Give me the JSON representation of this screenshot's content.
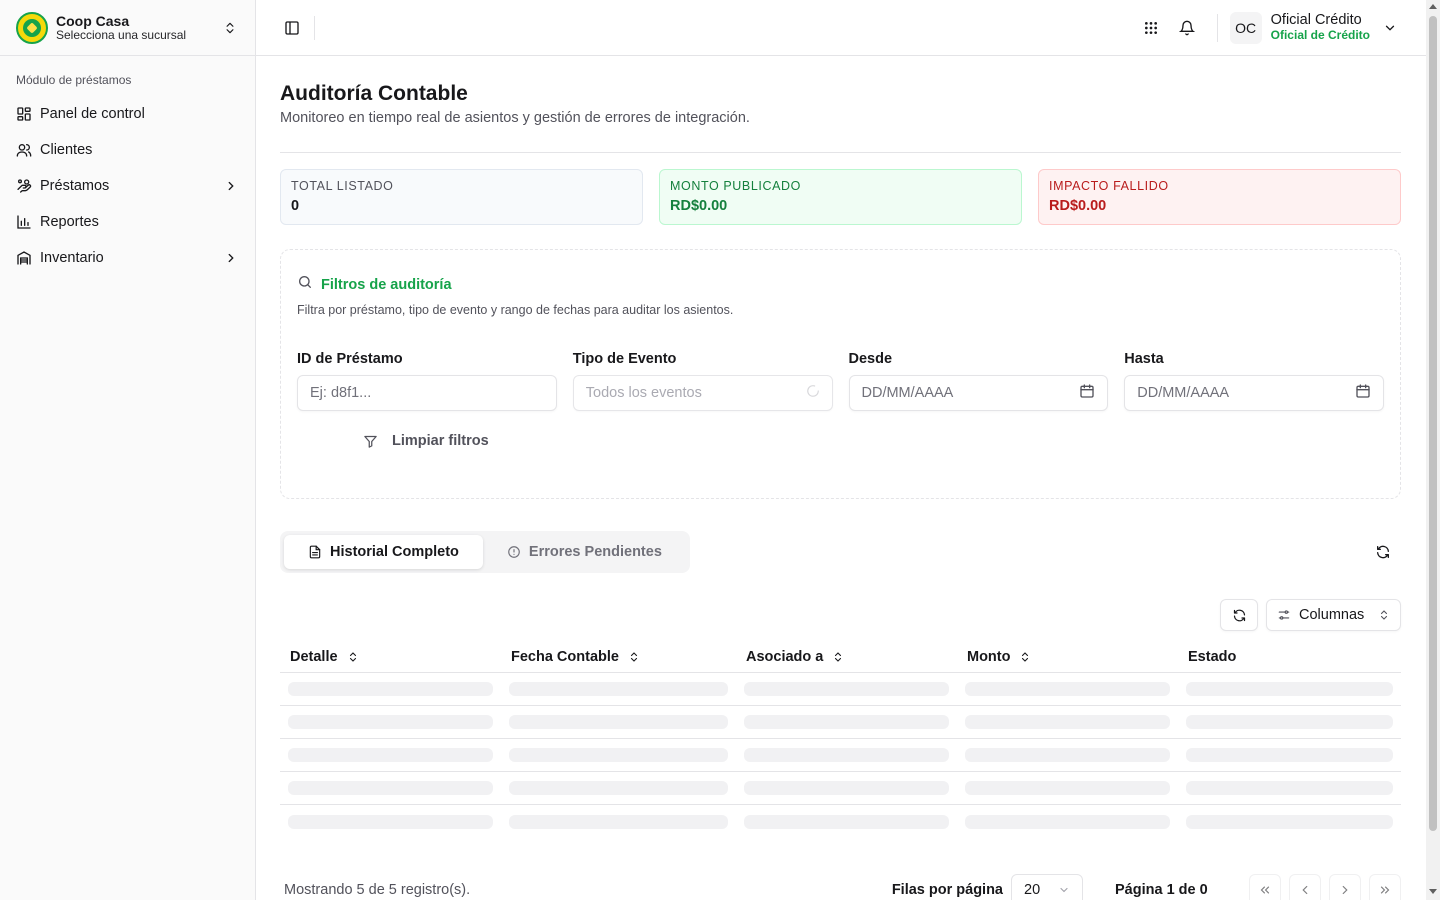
{
  "brand": {
    "title": "Coop Casa",
    "subtitle": "Selecciona una sucursal"
  },
  "sidebar": {
    "heading": "Módulo de préstamos",
    "items": [
      {
        "label": "Panel de control",
        "icon": "dashboard-icon"
      },
      {
        "label": "Clientes",
        "icon": "users-icon"
      },
      {
        "label": "Préstamos",
        "icon": "loans-icon",
        "has_children": true
      },
      {
        "label": "Reportes",
        "icon": "chart-icon"
      },
      {
        "label": "Inventario",
        "icon": "inventory-icon",
        "has_children": true
      }
    ]
  },
  "header": {
    "user_initials": "OC",
    "user_name": "Oficial Crédito",
    "user_role": "Oficial de Crédito"
  },
  "page": {
    "title": "Auditoría Contable",
    "subtitle": "Monitoreo en tiempo real de asientos y gestión de errores de integración."
  },
  "stats": [
    {
      "label": "TOTAL LISTADO",
      "value": "0"
    },
    {
      "label": "MONTO PUBLICADO",
      "value": "RD$0.00"
    },
    {
      "label": "IMPACTO FALLIDO",
      "value": "RD$0.00"
    }
  ],
  "filters": {
    "title": "Filtros de auditoría",
    "description": "Filtra por préstamo, tipo de evento y rango de fechas para auditar los asientos.",
    "loan_id": {
      "label": "ID de Préstamo",
      "placeholder": "Ej: d8f1..."
    },
    "event_type": {
      "label": "Tipo de Evento",
      "placeholder": "Todos los eventos"
    },
    "from": {
      "label": "Desde",
      "placeholder": "DD/MM/AAAA"
    },
    "to": {
      "label": "Hasta",
      "placeholder": "DD/MM/AAAA"
    },
    "clear_label": "Limpiar filtros"
  },
  "tabs": [
    {
      "label": "Historial Completo",
      "active": true
    },
    {
      "label": "Errores Pendientes",
      "active": false
    }
  ],
  "table": {
    "columns_button": "Columnas",
    "headers": [
      "Detalle",
      "Fecha Contable",
      "Asociado a",
      "Monto",
      "Estado"
    ]
  },
  "footer": {
    "count_text": "Mostrando 5 de 5 registro(s).",
    "rows_label": "Filas por página",
    "rows_value": "20",
    "page_text": "Página 1 de 0"
  },
  "colors": {
    "accent": "#16a34a",
    "danger": "#b91c1c",
    "border": "#e4e4e7"
  }
}
